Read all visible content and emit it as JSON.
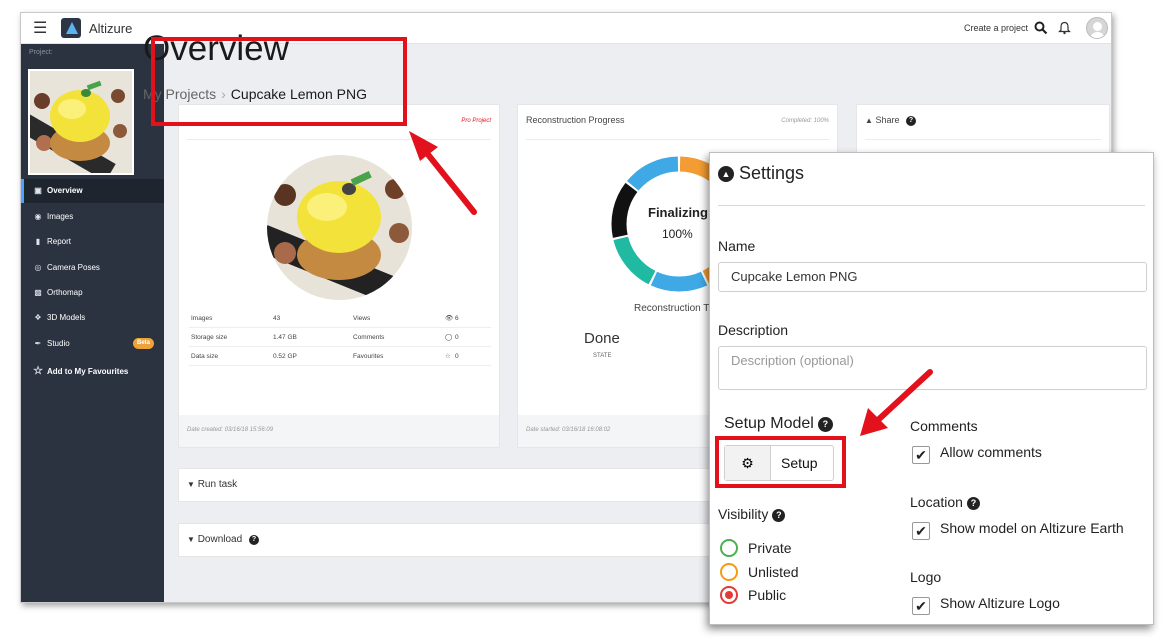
{
  "app": {
    "name": "Altizure",
    "create_project": "Create a project"
  },
  "sidebar": {
    "project_label": "Project:",
    "items": [
      {
        "label": "Overview",
        "icon": "briefcase-icon"
      },
      {
        "label": "Images",
        "icon": "camera-icon"
      },
      {
        "label": "Report",
        "icon": "file-icon"
      },
      {
        "label": "Camera Poses",
        "icon": "target-icon"
      },
      {
        "label": "Orthomap",
        "icon": "image-icon"
      },
      {
        "label": "3D Models",
        "icon": "cube-icon"
      },
      {
        "label": "Studio",
        "icon": "paint-icon",
        "badge": "Beta"
      },
      {
        "label": "Add to My Favourites",
        "icon": "star-icon"
      }
    ]
  },
  "header": {
    "title": "Overview",
    "breadcrumb": [
      "My Projects",
      "Cupcake Lemon PNG"
    ]
  },
  "info_card": {
    "badge": "Pro Project",
    "stats": [
      {
        "label": "Images",
        "value": "43",
        "label2": "Views",
        "value2": "6"
      },
      {
        "label": "Storage size",
        "value": "1.47 GB",
        "label2": "Comments",
        "value2": "0"
      },
      {
        "label": "Data size",
        "value": "0.52 GP",
        "label2": "Favourites",
        "value2": "0"
      }
    ],
    "footer": "Date created: 03/16/18 15:56:09"
  },
  "progress_card": {
    "title": "Reconstruction Progress",
    "completed": "Completed: 100%",
    "status": "Finalizing",
    "percent": "100%",
    "percent_value": 100,
    "reconstruction_label": "Reconstruction T",
    "state_value": "Done",
    "state_label": "STATE",
    "footer": "Date started: 03/16/18 16:08:02",
    "ring_colors": [
      "#f39c33",
      "#e74c3c",
      "#f39c33",
      "#3fa9e6",
      "#20b9a2",
      "#111111",
      "#3fa9e6"
    ]
  },
  "share_card": {
    "title": "Share"
  },
  "bars": {
    "run_task": "Run task",
    "download": "Download"
  },
  "settings": {
    "title": "Settings",
    "name_label": "Name",
    "name_value": "Cupcake Lemon PNG",
    "description_label": "Description",
    "description_placeholder": "Description (optional)",
    "setup_model_label": "Setup Model",
    "setup_button": "Setup",
    "visibility_label": "Visibility",
    "visibility_options": [
      {
        "label": "Private",
        "color": "#4caf50",
        "selected": false
      },
      {
        "label": "Unlisted",
        "color": "#f39c12",
        "selected": false
      },
      {
        "label": "Public",
        "color": "#e53935",
        "selected": true
      }
    ],
    "comments_label": "Comments",
    "comments_check": "Allow comments",
    "location_label": "Location",
    "location_check": "Show model on Altizure Earth",
    "logo_label": "Logo",
    "logo_check": "Show Altizure Logo"
  },
  "highlight_color": "#e3111b"
}
